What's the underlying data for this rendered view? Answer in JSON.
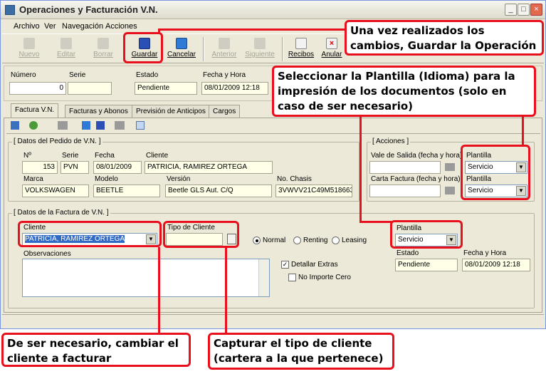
{
  "window": {
    "title": "Operaciones y Facturación V.N."
  },
  "menu": [
    "Archivo",
    "Ver",
    "Navegación",
    "Acciones"
  ],
  "toolbar": [
    {
      "label": "Nuevo",
      "icon": "new-document-icon",
      "enabled": false
    },
    {
      "label": "Editar",
      "icon": "edit-icon",
      "enabled": false
    },
    {
      "label": "Borrar",
      "icon": "delete-icon",
      "enabled": false
    },
    {
      "label": "Guardar",
      "icon": "floppy-disk-icon",
      "enabled": true
    },
    {
      "label": "Cancelar",
      "icon": "undo-icon",
      "enabled": true
    },
    {
      "label": "Anterior",
      "icon": "up-arrow-icon",
      "enabled": false
    },
    {
      "label": "Siguiente",
      "icon": "down-arrow-icon",
      "enabled": false
    },
    {
      "label": "Recibos",
      "icon": "receipt-icon",
      "enabled": true
    },
    {
      "label": "Anular",
      "icon": "cancel-document-icon",
      "enabled": true
    }
  ],
  "header": {
    "numero_label": "Número",
    "numero": "0",
    "serie_label": "Serie",
    "serie": "",
    "estado_label": "Estado",
    "estado": "Pendiente",
    "fecha_label": "Fecha y Hora",
    "fecha": "08/01/2009 12:18"
  },
  "tabs": [
    "Factura V.N.",
    "Facturas y Abonos",
    "Previsión de Anticipos",
    "Cargos"
  ],
  "pedido": {
    "title": "[ Datos del Pedido de V.N. ]",
    "no_label": "Nº",
    "no": "153",
    "serie_label": "Serie",
    "serie": "PVN",
    "fecha_label": "Fecha",
    "fecha": "08/01/2009",
    "cliente_label": "Cliente",
    "cliente": "PATRICIA, RAMIREZ ORTEGA",
    "marca_label": "Marca",
    "marca": "VOLKSWAGEN",
    "modelo_label": "Modelo",
    "modelo": "BEETLE",
    "version_label": "Versión",
    "version": "Beetle GLS Aut. C/Q",
    "chasis_label": "No. Chasis",
    "chasis": "3VWVV21C49M518663"
  },
  "acciones": {
    "title": "[ Acciones ]",
    "vale_label": "Vale de Salida (fecha y hora)",
    "carta_label": "Carta Factura (fecha y hora)",
    "plantilla_label": "Plantilla",
    "plantilla1": "Servicio",
    "plantilla2": "Servicio"
  },
  "factura": {
    "title": "[ Datos de la Factura de V.N. ]",
    "cliente_label": "Cliente",
    "cliente": "PATRICIA, RAMIREZ ORTEGA",
    "tipo_label": "Tipo de Cliente",
    "tipo": "",
    "radio_normal": "Normal",
    "radio_renting": "Renting",
    "radio_leasing": "Leasing",
    "plantilla_label": "Plantilla",
    "plantilla": "Servicio",
    "observaciones_label": "Observaciones",
    "detallar_label": "Detallar Extras",
    "no_importe_label": "No Importe Cero",
    "estado_label": "Estado",
    "estado": "Pendiente",
    "fecha_label": "Fecha y Hora",
    "fecha": "08/01/2009 12:18"
  },
  "callouts": {
    "guardar": "Una vez realizados los cambios, Guardar la Operación",
    "plantilla": "Seleccionar la Plantilla (Idioma) para la impresión de los documentos (solo en caso de ser necesario)",
    "cliente": "De ser necesario, cambiar el cliente a facturar",
    "tipo": "Capturar el tipo de cliente (cartera a la que pertenece)"
  },
  "colors": {
    "annotation_red": "#e8101c",
    "field_yellow": "#ffffe8",
    "window_bg": "#ece9d8"
  }
}
